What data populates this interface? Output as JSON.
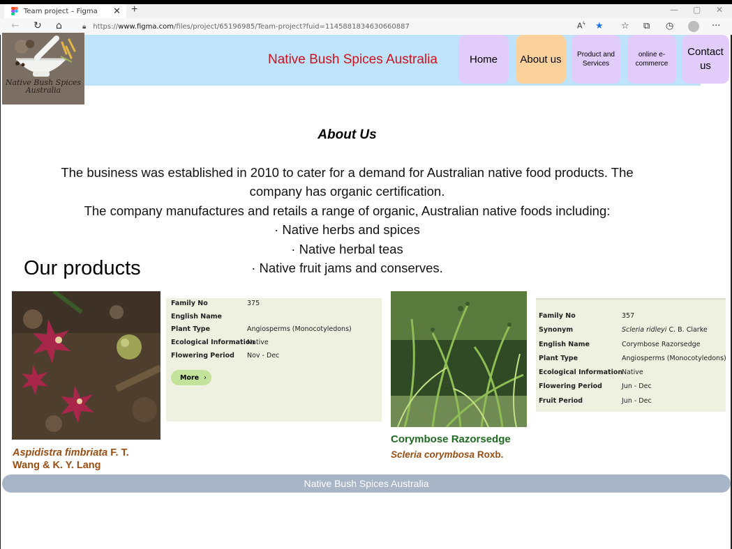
{
  "browser": {
    "tab_title": "Team project – Figma",
    "url_prefix": "https://",
    "url_host": "www.figma.com",
    "url_path": "/files/project/65196985/Team-project?fuid=1145881834630660887",
    "icons": [
      "back-icon",
      "refresh-icon",
      "home-icon",
      "lock-icon",
      "read-aloud-icon",
      "favorite-star-icon",
      "favorites-icon",
      "collections-icon",
      "history-icon",
      "profile-icon",
      "more-icon"
    ]
  },
  "site": {
    "title": "Native Bush Spices Australia",
    "logo_text_line1": "Native Bush Spices",
    "logo_text_line2": "Australia",
    "nav": {
      "home": "Home",
      "about": "About us",
      "products_line1": "Product and",
      "products_line2": "Services",
      "ecommerce_line1": "online e-",
      "ecommerce_line2": "commerce",
      "contact_line1": "Contact",
      "contact_line2": "us"
    },
    "active_nav": "About us",
    "colors": {
      "header_bg": "#bee3fb",
      "title_red": "#d0121b",
      "nav_bg": "#e2ccfb",
      "nav_active_bg": "#fdd19b",
      "card_bg": "#eef0e0",
      "footer_bg": "#a7b5c6"
    }
  },
  "about": {
    "title": "About Us",
    "line1": "The business was established in 2010 to cater for a demand for Australian native food products. The",
    "line2": "company has organic certification.",
    "line3": "The company manufactures and retails a range of organic, Australian native foods including:",
    "line4": "· Native herbs and spices",
    "line5": "· Native herbal teas",
    "line6": "· Native fruit jams and conserves."
  },
  "products": {
    "heading": "Our products",
    "product1": {
      "labels": {
        "family": "Family No",
        "english": "English Name",
        "plant": "Plant Type",
        "eco": "Ecological Information",
        "flowering": "Flowering Period"
      },
      "values": {
        "family": "375",
        "english": "",
        "plant": "Angiosperms (Monocotyledons)",
        "eco": "Native",
        "flowering": "Nov - Dec"
      },
      "more_label": "More",
      "sci_italic": "Aspidistra fimbriata",
      "sci_author_1": " F. T.",
      "sci_author_2": "Wang & K. Y. Lang"
    },
    "product2": {
      "labels": {
        "family": "Family No",
        "synonym": "Synonym",
        "english": "English Name",
        "plant": "Plant Type",
        "eco": "Ecological Information",
        "flowering": "Flowering Period",
        "fruit": "Fruit Period"
      },
      "values": {
        "family": "357",
        "synonym_italic": "Scleria ridleyi",
        "synonym_author": " C. B. Clarke",
        "english": "Corymbose Razorsedge",
        "plant": "Angiosperms (Monocotyledons)",
        "eco": "Native",
        "flowering": "Jun - Dec",
        "fruit": "Jun - Dec"
      },
      "common_name": "Corymbose Razorsedge",
      "sci_italic": "Scleria corymbosa",
      "sci_author": " Roxb."
    }
  },
  "footer": {
    "text": "Native Bush Spices Australia"
  }
}
